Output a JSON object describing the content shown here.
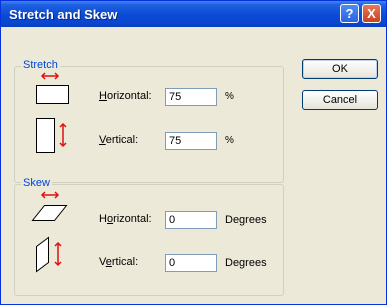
{
  "window": {
    "title": "Stretch and Skew",
    "help_label": "?",
    "close_label": "X"
  },
  "stretch": {
    "group_label": "Stretch",
    "horizontal": {
      "label_hotkey": "H",
      "label_rest": "orizontal:",
      "value": "75",
      "unit": "%"
    },
    "vertical": {
      "label_hotkey": "V",
      "label_rest": "ertical:",
      "value": "75",
      "unit": "%"
    }
  },
  "skew": {
    "group_label": "Skew",
    "horizontal": {
      "label_pre": "H",
      "label_hotkey": "o",
      "label_rest": "rizontal:",
      "value": "0",
      "unit": "Degrees"
    },
    "vertical": {
      "label_pre": "V",
      "label_hotkey": "e",
      "label_rest": "rtical:",
      "value": "0",
      "unit": "Degrees"
    }
  },
  "buttons": {
    "ok": "OK",
    "cancel": "Cancel"
  },
  "icons": {
    "stretch_horizontal": "stretch-horizontal-icon",
    "stretch_vertical": "stretch-vertical-icon",
    "skew_horizontal": "skew-horizontal-icon",
    "skew_vertical": "skew-vertical-icon"
  },
  "colors": {
    "titlebar": "#0a4ad6",
    "group_label": "#0046d5",
    "arrow": "#e01010"
  }
}
